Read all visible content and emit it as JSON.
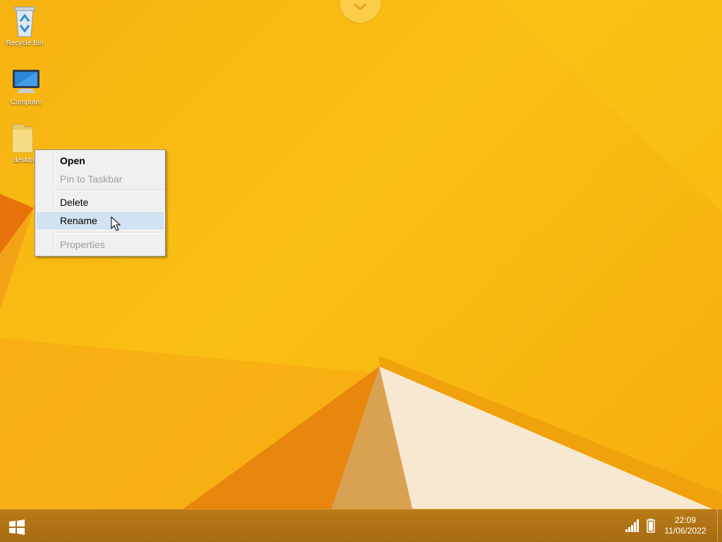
{
  "desktop": {
    "icons": [
      {
        "label": "Recycle Bin",
        "icon": "recycle-bin-icon"
      },
      {
        "label": "Computer",
        "icon": "computer-icon"
      },
      {
        "label": "deskto",
        "icon": "folder-icon"
      }
    ]
  },
  "context_menu": {
    "items": [
      {
        "label": "Open",
        "state": "default-bold"
      },
      {
        "label": "Pin to Taskbar",
        "state": "disabled"
      },
      {
        "label": "Delete",
        "state": "enabled"
      },
      {
        "label": "Rename",
        "state": "hovered"
      },
      {
        "label": "Properties",
        "state": "disabled"
      }
    ]
  },
  "taskbar": {
    "start_icon": "windows-logo-icon",
    "tray": {
      "signal_icon": "network-signal-icon",
      "battery_icon": "battery-icon",
      "time": "22:09",
      "date": "11/06/2022"
    }
  },
  "colors": {
    "wallpaper": "#f7b311",
    "taskbar": "#a66c12",
    "menu_background": "#f0f0f0",
    "menu_hover": "#d1e2f2"
  }
}
